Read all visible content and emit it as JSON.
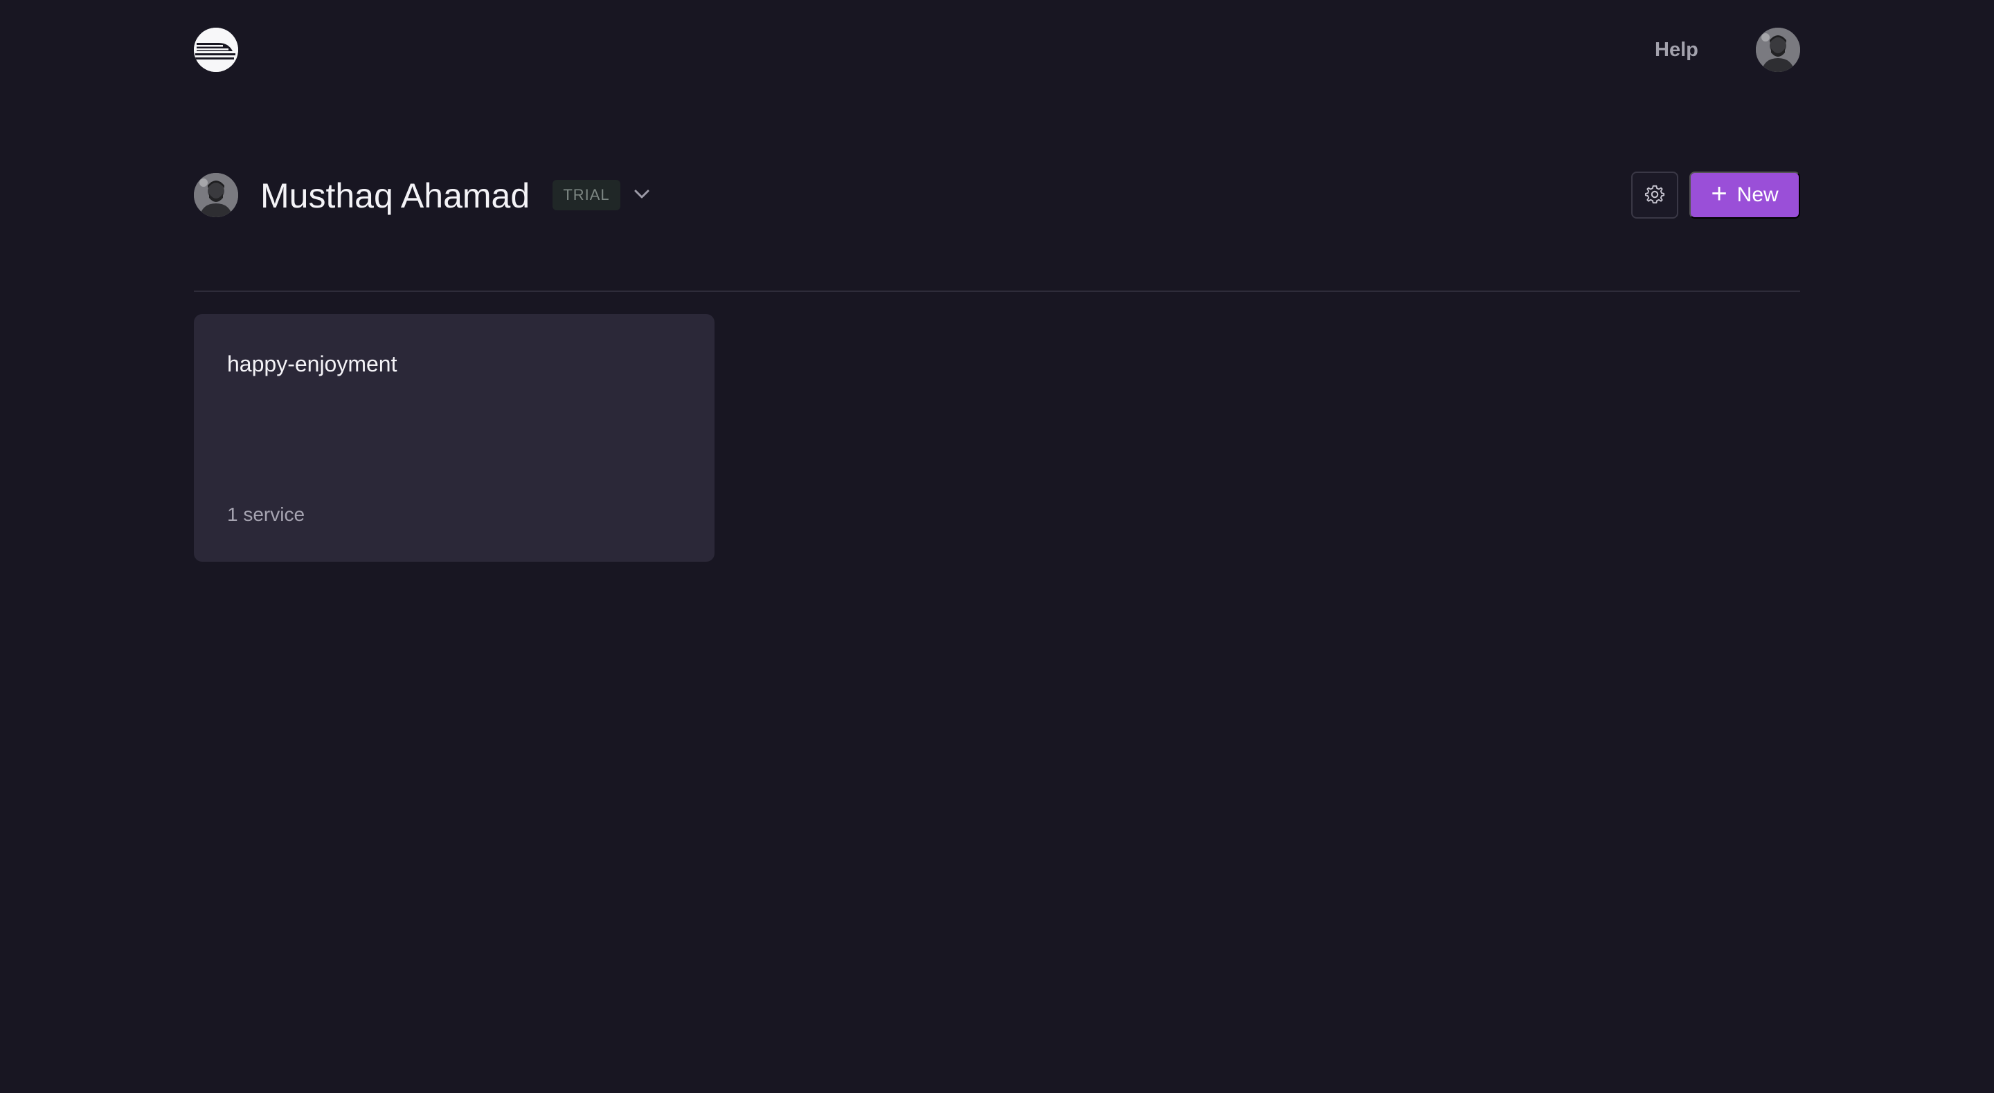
{
  "topbar": {
    "logo_icon": "railway-logo-icon",
    "help_label": "Help",
    "avatar_icon": "user-avatar-icon"
  },
  "header": {
    "account_name": "Musthaq Ahamad",
    "plan_badge": "TRIAL",
    "dropdown_icon": "chevron-down-icon",
    "settings_icon": "gear-icon",
    "new_button_label": "New",
    "new_button_icon": "plus-icon"
  },
  "projects": [
    {
      "name": "happy-enjoyment",
      "services": "1 service"
    }
  ],
  "colors": {
    "background": "#181622",
    "card": "#2b2838",
    "accent": "#9a4fd8",
    "badge_bg": "#202727",
    "badge_text": "#7d8783"
  }
}
